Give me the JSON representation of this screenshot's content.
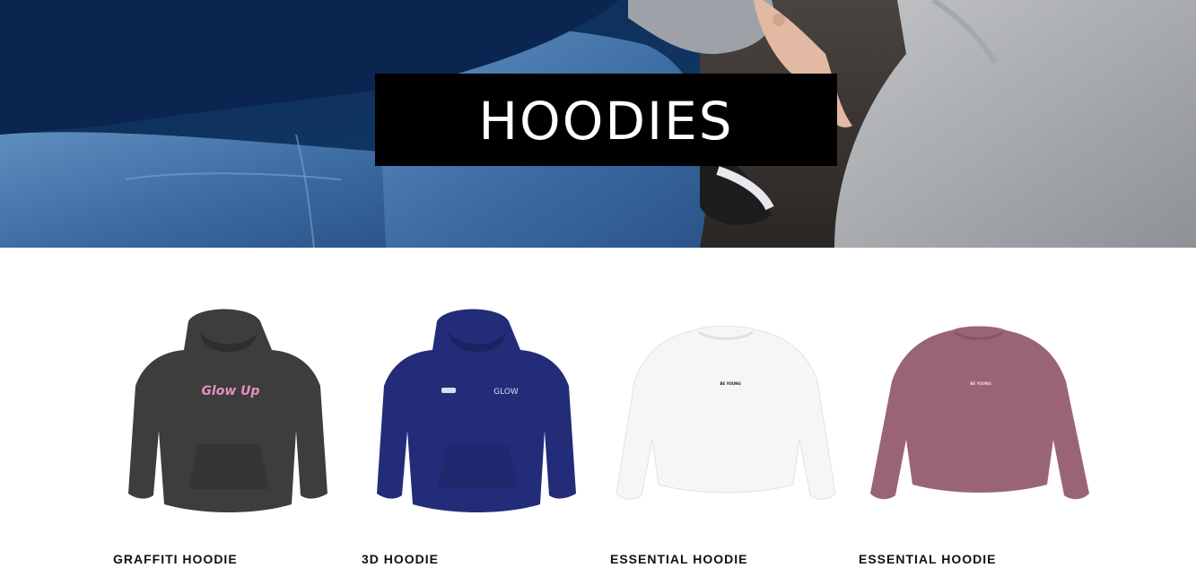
{
  "hero": {
    "title": "HOODIES",
    "title_bg": "#000000",
    "title_color": "#ffffff"
  },
  "products": [
    {
      "name": "GRAFFITI HOODIE",
      "color": "#3d3d3d",
      "print": "Glow Up",
      "print_color": "#e58fc0",
      "style": "hoodie"
    },
    {
      "name": "3D HOODIE",
      "color": "#232c78",
      "print": "GLOW",
      "print_color": "#d8dcf2",
      "style": "hoodie"
    },
    {
      "name": "ESSENTIAL HOODIE",
      "color": "#f6f6f6",
      "print": "BE YOUNG",
      "print_color": "#222222",
      "style": "crewneck"
    },
    {
      "name": "ESSENTIAL HOODIE",
      "color": "#9a6478",
      "print": "BE YOUNG",
      "print_color": "#f1dce4",
      "style": "crewneck"
    }
  ]
}
